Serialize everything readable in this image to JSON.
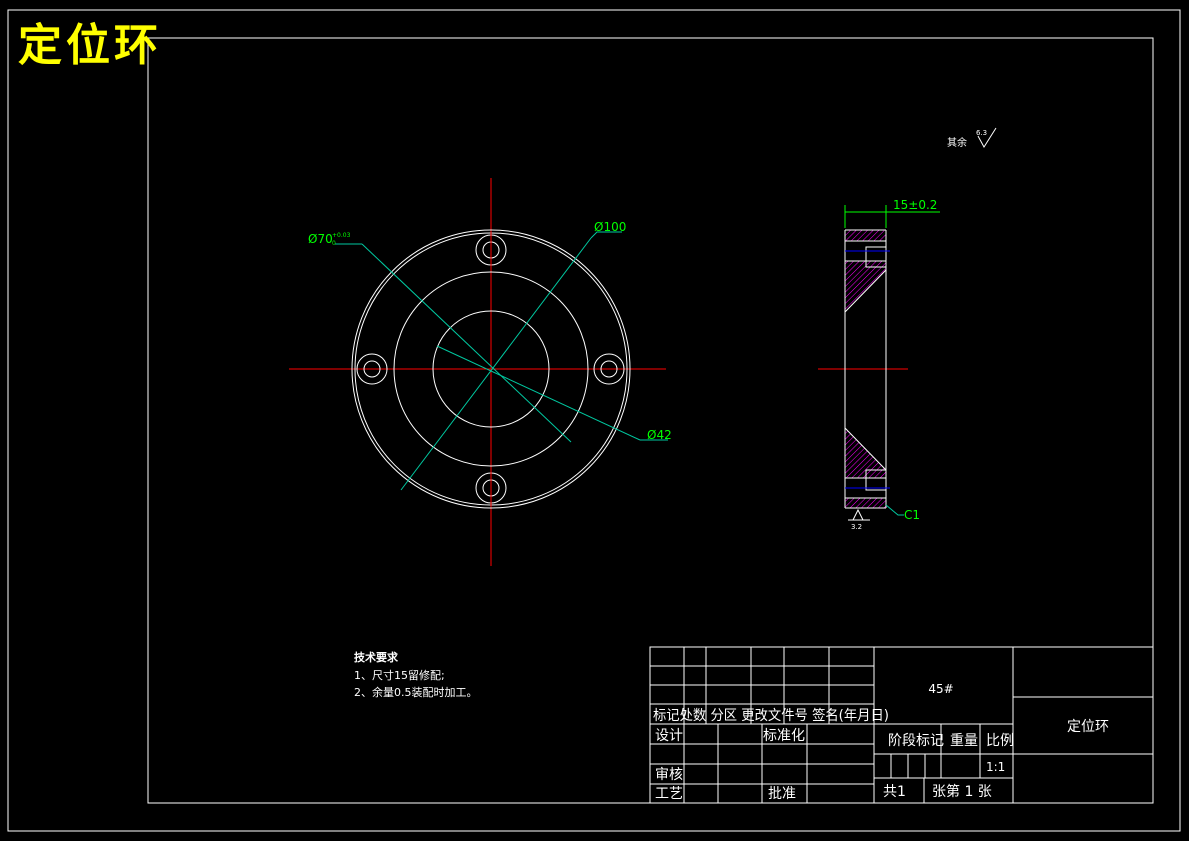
{
  "title": "定位环",
  "roughness_general": {
    "label": "其余",
    "value": "6.3"
  },
  "dims": {
    "d70": "Ø70",
    "d70_tol_upper": "+0.03",
    "d70_tol_lower": "0",
    "d100": "Ø100",
    "d42": "Ø42",
    "thickness": "15±0.2",
    "chamfer": "C1",
    "roughness_face": "3.2"
  },
  "tech_req": {
    "heading": "技术要求",
    "items": [
      "1、尺寸15留修配;",
      "2、余量0.5装配时加工。"
    ]
  },
  "title_block": {
    "material": "45#",
    "part_name": "定位环",
    "rev_header": "标记处数 分区 更改文件号 签名(年月日)",
    "design": "设计",
    "standardize": "标准化",
    "review": "审核",
    "process": "工艺",
    "approve": "批准",
    "stage_label": "阶段标记",
    "weight_label": "重量",
    "scale_label": "比例",
    "scale": "1:1",
    "sheet_total": "共1",
    "sheet_no": "张第 1 张"
  },
  "colors": {
    "background": "#000000",
    "outline": "#ffffff",
    "center_line": "#ff0000",
    "dimension": "#00ff00",
    "leader": "#00c8a0",
    "hatch": "#ff00ff",
    "hidden": "#0000ff",
    "title": "#ffff00"
  }
}
